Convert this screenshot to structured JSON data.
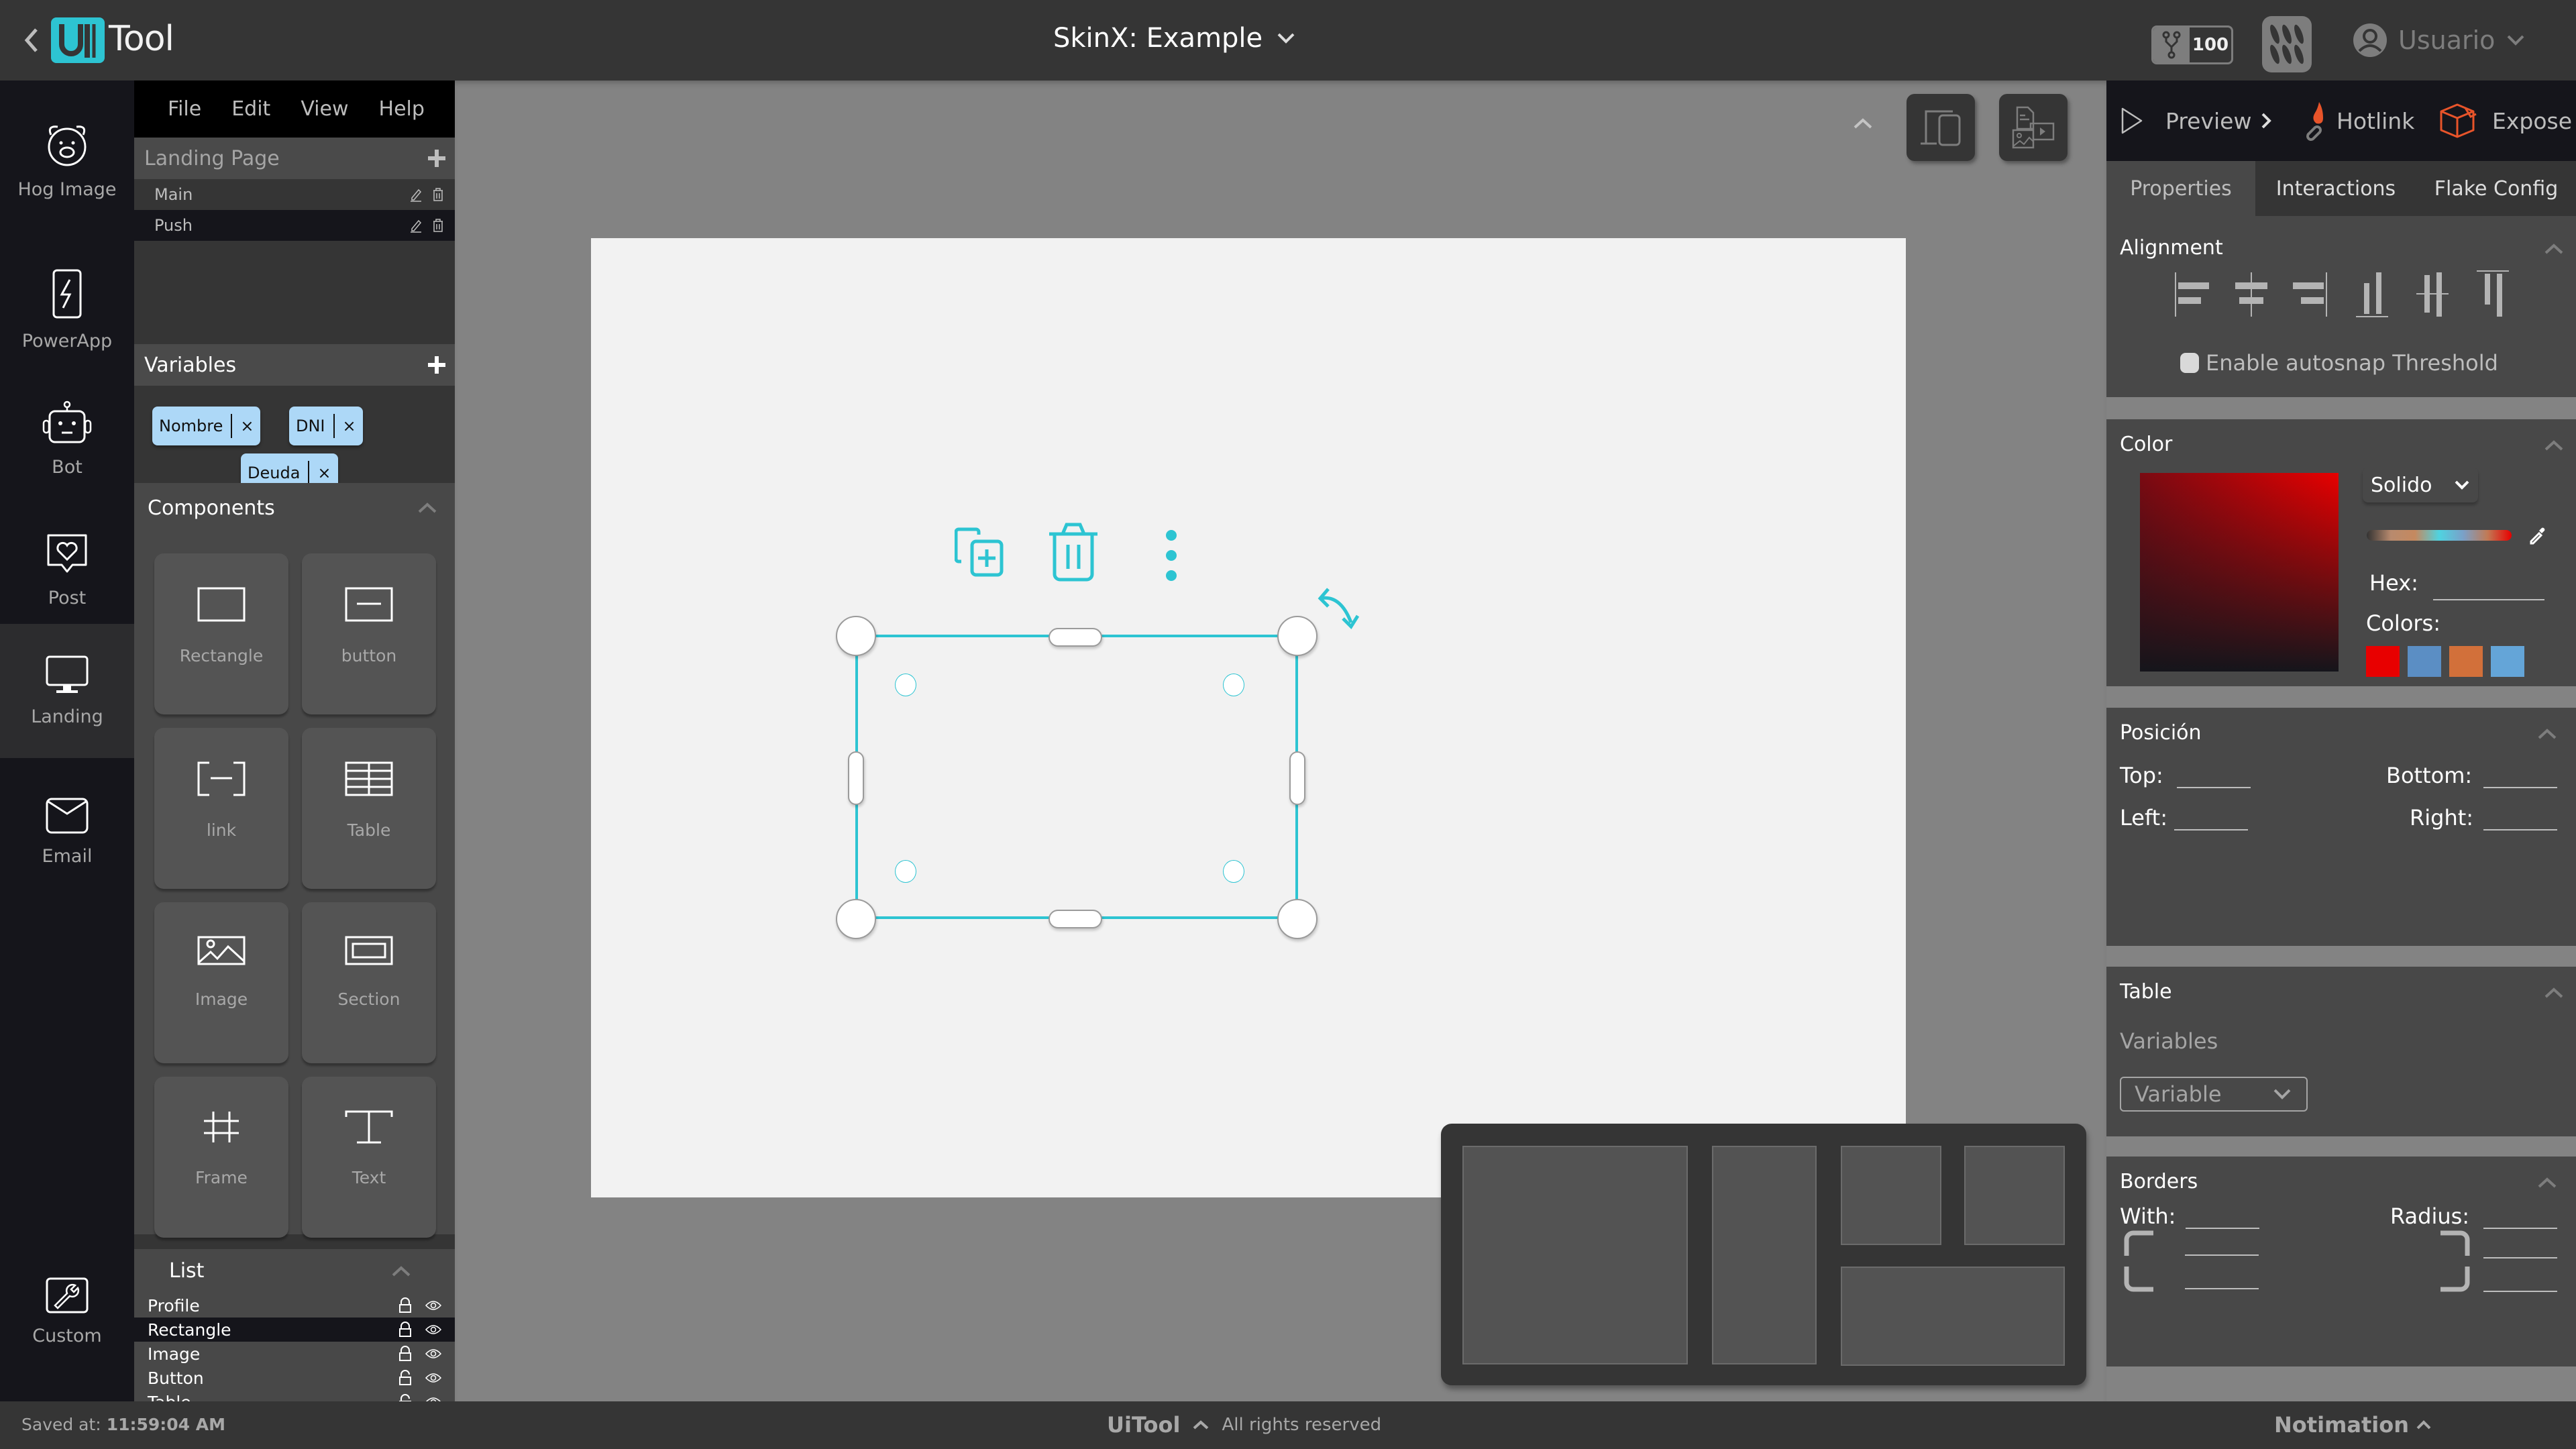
{
  "header": {
    "logo_text": "Tool",
    "logo_mark": "UI",
    "project_title": "SkinX: Example",
    "credits": "100",
    "user_label": "Usuario"
  },
  "rail": {
    "items": [
      {
        "label": "Hog Image",
        "icon": "pig-icon"
      },
      {
        "label": "PowerApp",
        "icon": "phone-bolt-icon"
      },
      {
        "label": "Bot",
        "icon": "robot-icon"
      },
      {
        "label": "Post",
        "icon": "heart-bubble-icon"
      },
      {
        "label": "Landing",
        "icon": "monitor-icon",
        "active": true
      },
      {
        "label": "Email",
        "icon": "envelope-icon"
      },
      {
        "label": "Custom",
        "icon": "wrench-icon"
      }
    ]
  },
  "menu": {
    "file": "File",
    "edit": "Edit",
    "view": "View",
    "help": "Help"
  },
  "pages": {
    "title": "Landing Page",
    "items": [
      {
        "name": "Main"
      },
      {
        "name": "Push",
        "selected": true
      }
    ]
  },
  "variables": {
    "title": "Variables",
    "chips": [
      "Nombre",
      "DNI",
      "Deuda"
    ],
    "remove_glyph": "×"
  },
  "components": {
    "title": "Components",
    "items": [
      {
        "label": "Rectangle",
        "icon": "rectangle-icon"
      },
      {
        "label": "button",
        "icon": "button-icon"
      },
      {
        "label": "link",
        "icon": "link-icon"
      },
      {
        "label": "Table",
        "icon": "table-icon"
      },
      {
        "label": "Image",
        "icon": "image-icon"
      },
      {
        "label": "Section",
        "icon": "section-icon"
      },
      {
        "label": "Frame",
        "icon": "frame-icon"
      },
      {
        "label": "Text",
        "icon": "text-icon"
      }
    ]
  },
  "layers": {
    "title": "List",
    "items": [
      {
        "name": "Profile",
        "locked": true
      },
      {
        "name": "Rectangle",
        "locked": true,
        "selected": true
      },
      {
        "name": "Image",
        "locked": true
      },
      {
        "name": "Button",
        "locked": false
      },
      {
        "name": "Table",
        "locked": false
      }
    ]
  },
  "right": {
    "actions": {
      "preview": "Preview",
      "hotlink": "Hotlink",
      "expose": "Expose"
    },
    "tabs": [
      "Properties",
      "Interactions",
      "Flake Config"
    ],
    "active_tab": "Properties",
    "alignment": {
      "title": "Alignment",
      "autosnap_label": "Enable autosnap Threshold",
      "autosnap_checked": false,
      "buttons": [
        "align-left",
        "align-center-h",
        "align-right",
        "align-bottom",
        "align-center-v",
        "align-top"
      ]
    },
    "color": {
      "title": "Color",
      "mode": "Solido",
      "hex_label": "Hex:",
      "hex_value": "",
      "colors_label": "Colors:",
      "swatches": [
        "#e80000",
        "#5b8ec4",
        "#d2703a",
        "#64a5d8"
      ],
      "picker_hue": "#e80000"
    },
    "position": {
      "title": "Posición",
      "top_label": "Top:",
      "bottom_label": "Bottom:",
      "left_label": "Left:",
      "right_label": "Right:",
      "top": "",
      "bottom": "",
      "left": "",
      "right": ""
    },
    "table": {
      "title": "Table",
      "variables_label": "Variables",
      "select_placeholder": "Variable"
    },
    "borders": {
      "title": "Borders",
      "width_label": "With:",
      "radius_label": "Radius:"
    }
  },
  "status": {
    "saved_prefix": "Saved at:",
    "saved_time": "11:59:04 AM",
    "brand": "UiTool",
    "rights": "All rights reserved",
    "notimation": "Notimation"
  },
  "colors": {
    "accent": "#2dc4d2",
    "hotlink": "#e8542a",
    "expose": "#e8542a",
    "chip": "#add8f7"
  }
}
